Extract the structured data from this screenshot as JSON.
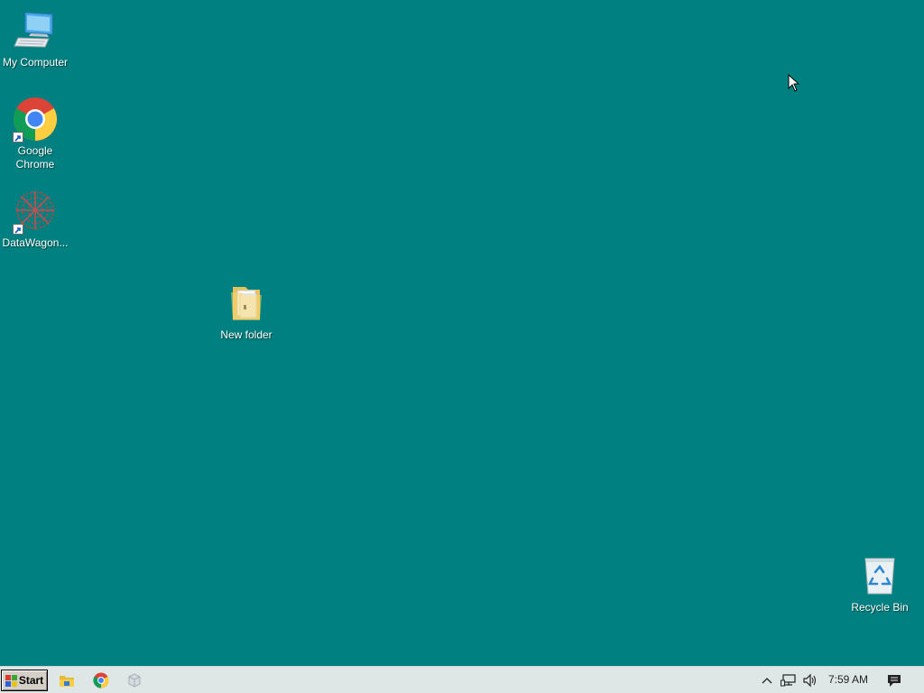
{
  "desktop": {
    "background_color": "#008080",
    "icons": [
      {
        "label": "My Computer",
        "icon": "computer-icon"
      },
      {
        "label": "Google\nChrome",
        "icon": "chrome-icon",
        "shortcut": true
      },
      {
        "label": "DataWagon...",
        "icon": "datawagon-icon",
        "shortcut": true
      },
      {
        "label": "New folder",
        "icon": "folder-icon"
      },
      {
        "label": "Recycle Bin",
        "icon": "recycle-bin-icon"
      }
    ]
  },
  "taskbar": {
    "start_label": "Start",
    "pinned_apps": [
      {
        "icon": "file-explorer-icon"
      },
      {
        "icon": "chrome-icon"
      },
      {
        "icon": "app-icon"
      }
    ],
    "tray": {
      "icons": [
        "chevron-up-icon",
        "network-icon",
        "volume-icon",
        "notification-icon"
      ],
      "clock": "7:59 AM"
    }
  }
}
